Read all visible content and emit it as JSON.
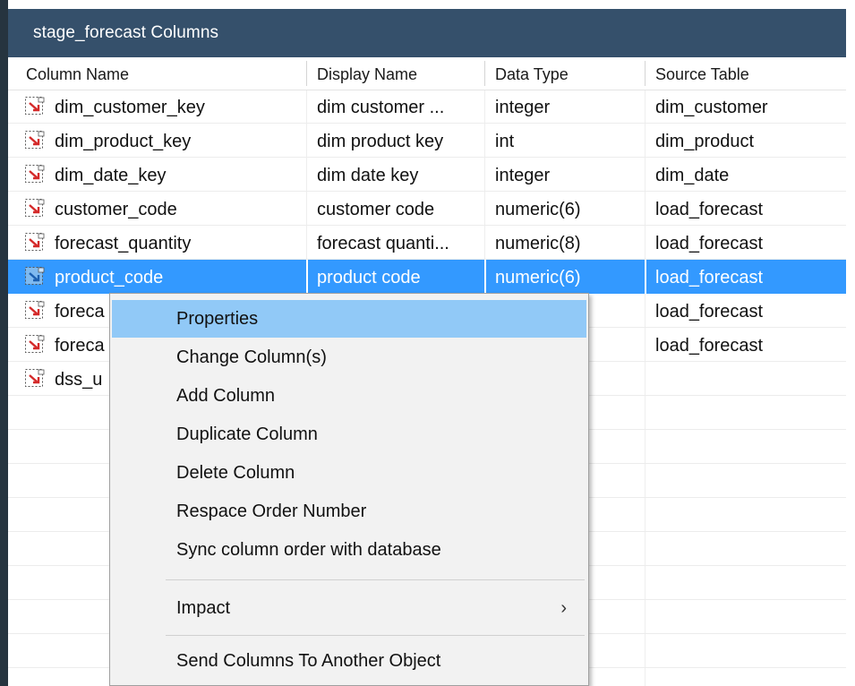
{
  "window": {
    "title": "stage_forecast Columns"
  },
  "columns": {
    "headers": [
      "Column Name",
      "Display Name",
      "Data Type",
      "Source Table"
    ]
  },
  "rows": [
    {
      "name": "dim_customer_key",
      "display": "dim customer ...",
      "type": "integer",
      "source": "dim_customer"
    },
    {
      "name": "dim_product_key",
      "display": "dim product key",
      "type": "int",
      "source": "dim_product"
    },
    {
      "name": "dim_date_key",
      "display": "dim date key",
      "type": "integer",
      "source": "dim_date"
    },
    {
      "name": "customer_code",
      "display": "customer code",
      "type": "numeric(6)",
      "source": "load_forecast"
    },
    {
      "name": "forecast_quantity",
      "display": "forecast quanti...",
      "type": "numeric(8)",
      "source": "load_forecast"
    },
    {
      "name": "product_code",
      "display": "product code",
      "type": "numeric(6)",
      "source": "load_forecast",
      "selected": true
    },
    {
      "name": "foreca",
      "display": "",
      "type": ",2)",
      "source": "load_forecast"
    },
    {
      "name": "foreca",
      "display": "",
      "type": "",
      "source": "load_forecast"
    },
    {
      "name": "dss_u",
      "display": "",
      "type": "",
      "source": ""
    }
  ],
  "context_menu": {
    "items": [
      {
        "label": "Properties",
        "highlighted": true
      },
      {
        "label": "Change Column(s)"
      },
      {
        "label": "Add Column"
      },
      {
        "label": "Duplicate Column"
      },
      {
        "label": "Delete Column"
      },
      {
        "label": "Respace Order Number"
      },
      {
        "label": "Sync column order with database"
      },
      {
        "label": "Impact",
        "submenu": true,
        "submenu_icon": "chevron-right-icon",
        "submenu_glyph": "›"
      },
      {
        "label": "Send Columns To Another Object"
      }
    ]
  },
  "colors": {
    "title_bar": "#35506b",
    "selection": "#3399ff",
    "menu_highlight": "#91c9f7"
  },
  "icons": {
    "row_icon": "column-arrow-icon"
  }
}
